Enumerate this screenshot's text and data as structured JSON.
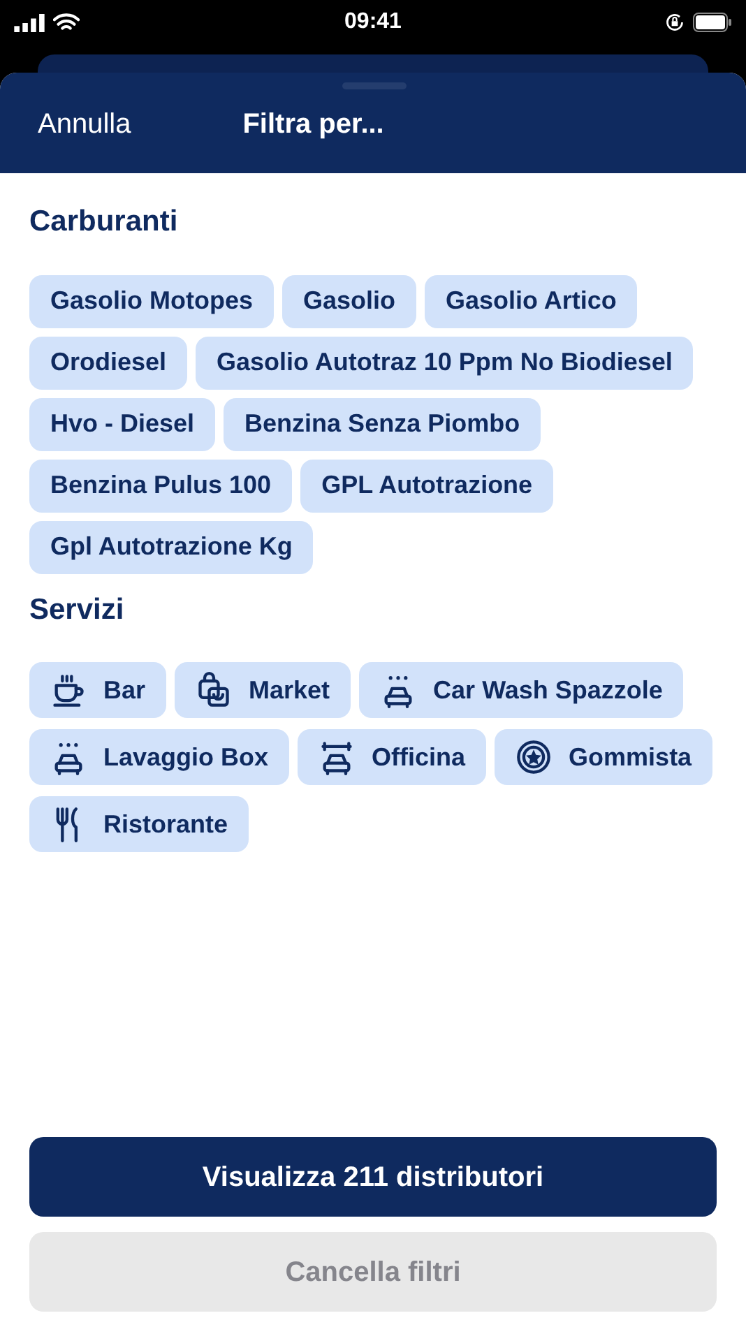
{
  "status_bar": {
    "time": "09:41"
  },
  "header": {
    "cancel": "Annulla",
    "title": "Filtra per..."
  },
  "sections": [
    {
      "title": "Carburanti",
      "chips": [
        {
          "label": "Gasolio Motopes",
          "selected": false
        },
        {
          "label": "Gasolio",
          "selected": false
        },
        {
          "label": "Gasolio Artico",
          "selected": false
        },
        {
          "label": "Orodiesel",
          "selected": false
        },
        {
          "label": "Gasolio Autotraz 10 Ppm No Biodiesel",
          "selected": false
        },
        {
          "label": "Hvo - Diesel",
          "selected": false
        },
        {
          "label": "Benzina Senza Piombo",
          "selected": false
        },
        {
          "label": "Benzina Pulus 100",
          "selected": false
        },
        {
          "label": "GPL Autotrazione",
          "selected": false
        },
        {
          "label": "Gpl Autotrazione Kg",
          "selected": false
        }
      ]
    },
    {
      "title": "Servizi",
      "chips": [
        {
          "label": "Bar",
          "selected": false,
          "kind": "cup"
        },
        {
          "label": "Market",
          "selected": false,
          "kind": "bag"
        },
        {
          "label": "Car Wash Spazzole",
          "selected": false,
          "kind": "wash"
        },
        {
          "label": "Lavaggio Box",
          "selected": false,
          "kind": "wash"
        },
        {
          "label": "Officina",
          "selected": false,
          "kind": "garage"
        },
        {
          "label": "Gommista",
          "selected": false,
          "kind": "tire"
        },
        {
          "label": "Ristorante",
          "selected": false,
          "kind": "cutlery"
        }
      ]
    }
  ],
  "buttons": {
    "primary": "Visualizza 211 distributori",
    "secondary": {
      "label": "Cancella filtri",
      "disabled": true
    }
  }
}
